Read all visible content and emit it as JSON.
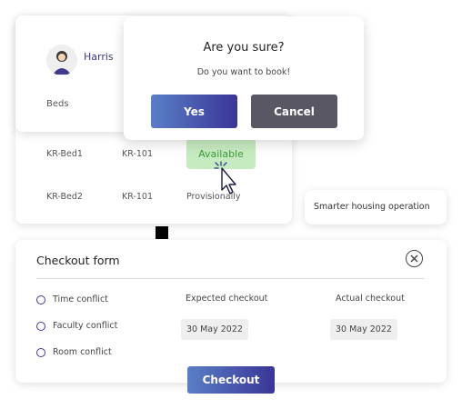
{
  "booking": {
    "user_name": "Harris",
    "column_beds": "Beds",
    "rows": [
      {
        "bed": "KR-Bed1",
        "room": "KR-101",
        "status": "Available"
      },
      {
        "bed": "KR-Bed2",
        "room": "KR-101",
        "status": "Provisionally"
      }
    ]
  },
  "dialog": {
    "title": "Are you sure?",
    "subtitle": "Do you want to book!",
    "yes_label": "Yes",
    "cancel_label": "Cancel"
  },
  "tag": {
    "text": "Smarter housing operation"
  },
  "checkout": {
    "title": "Checkout form",
    "options": [
      "Time conflict",
      "Faculty conflict",
      "Room conflict"
    ],
    "expected_label": "Expected checkout",
    "expected_value": "30 May 2022",
    "actual_label": "Actual checkout",
    "actual_value": "30 May 2022",
    "button_label": "Checkout"
  },
  "colors": {
    "accent": "#3e3a8c",
    "available_bg": "#c7ebc0",
    "available_text": "#3a9a3a",
    "cancel_bg": "#5a5765"
  },
  "icons": {
    "avatar": "user-avatar-icon",
    "close": "close-icon",
    "cursor": "hand-pointer-icon"
  }
}
